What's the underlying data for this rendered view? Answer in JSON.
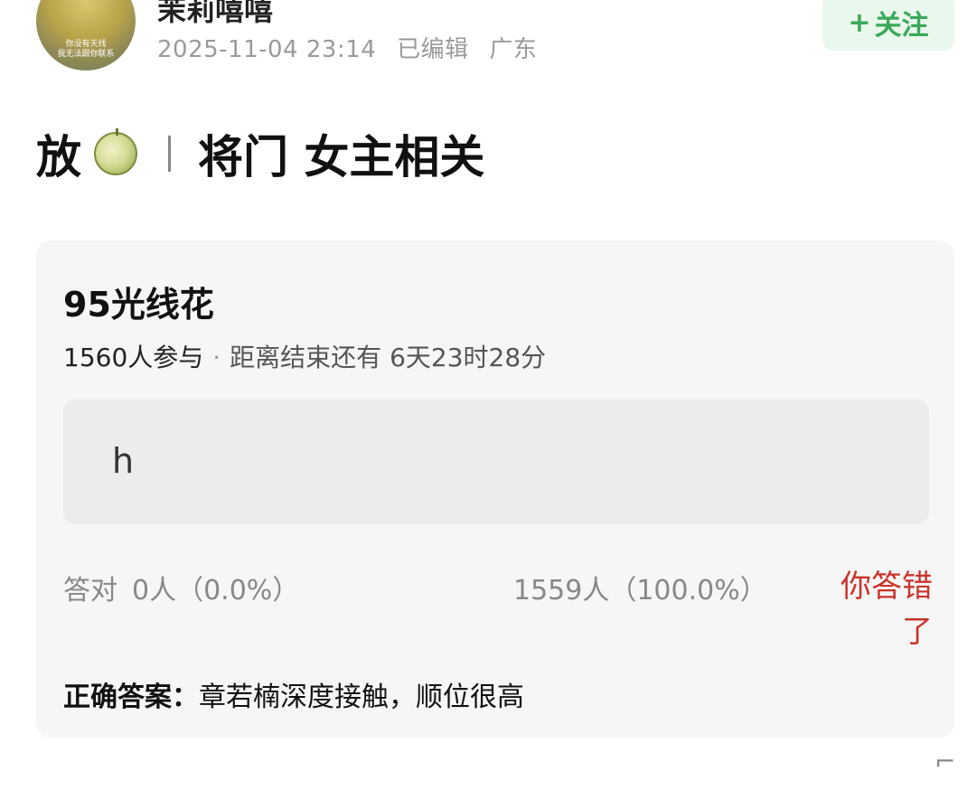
{
  "author": {
    "name": "茉莉嘻嘻",
    "avatar_caption_1": "你没有天线",
    "avatar_caption_2": "我无法跟你联系",
    "timestamp": "2025-11-04 23:14",
    "edited": "已编辑",
    "location": "广东"
  },
  "follow_button": {
    "plus": "+",
    "label": "关注"
  },
  "headline": {
    "lead": "放",
    "emoji_icon": "melon-icon",
    "title": "将门 女主相关"
  },
  "quiz": {
    "title": "95光线花",
    "participants": "1560人参与",
    "separator": "·",
    "countdown": "距离结束还有 6天23时28分",
    "option_text": "h",
    "correct_label": "答对",
    "correct_count": "0人（0.0%）",
    "chosen_count": "1559人（100.0%）",
    "wrong_label": "你答错了",
    "answer_label": "正确答案：",
    "answer_text": "章若楠深度接触，顺位很高"
  },
  "colors": {
    "accent_green": "#3aa95a",
    "follow_bg": "#e9f7ec",
    "wrong_red": "#c8342c"
  }
}
